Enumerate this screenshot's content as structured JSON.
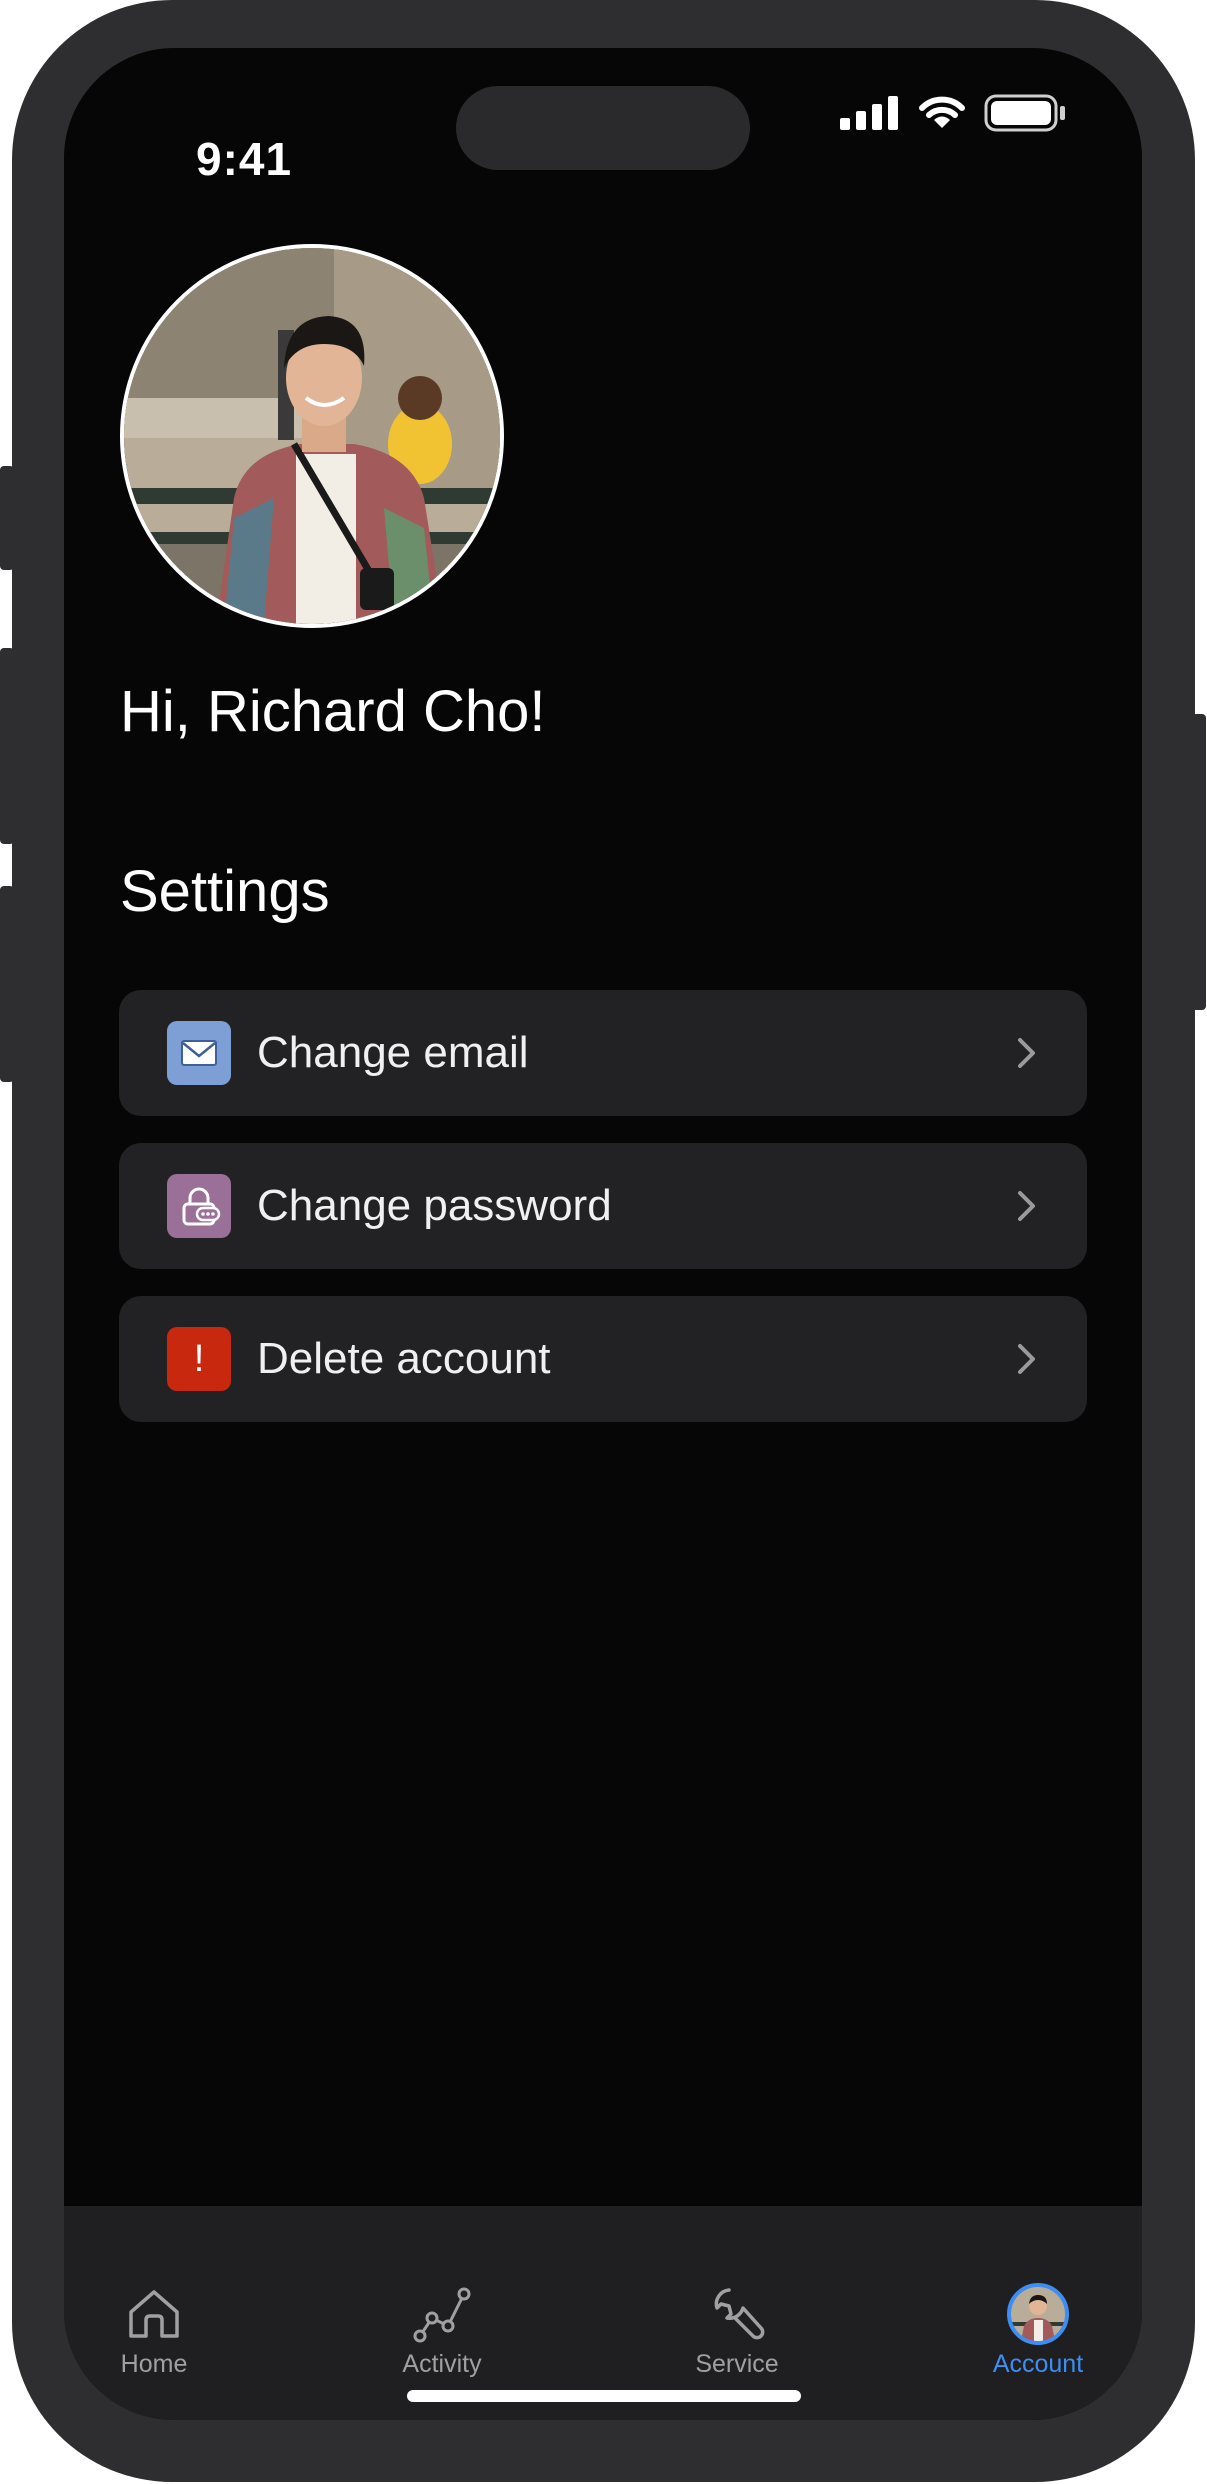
{
  "status_bar": {
    "time": "9:41",
    "icons": [
      "signal-icon",
      "wifi-icon",
      "battery-icon"
    ]
  },
  "profile": {
    "greeting": "Hi, Richard Cho!",
    "avatar": "profile-photo"
  },
  "settings": {
    "title": "Settings",
    "items": [
      {
        "label": "Change email",
        "icon": "mail-icon",
        "icon_color": "#7d9fd6"
      },
      {
        "label": "Change password",
        "icon": "lock-icon",
        "icon_color": "#9a6f98"
      },
      {
        "label": "Delete account",
        "icon": "alert-icon",
        "icon_color": "#c7280e",
        "icon_text": "!"
      }
    ]
  },
  "tab_bar": {
    "active": "Account",
    "active_color": "#3d8ef2",
    "tabs": [
      {
        "label": "Home",
        "icon": "home-icon"
      },
      {
        "label": "Activity",
        "icon": "activity-icon"
      },
      {
        "label": "Service",
        "icon": "wrench-icon"
      },
      {
        "label": "Account",
        "icon": "avatar"
      }
    ]
  }
}
